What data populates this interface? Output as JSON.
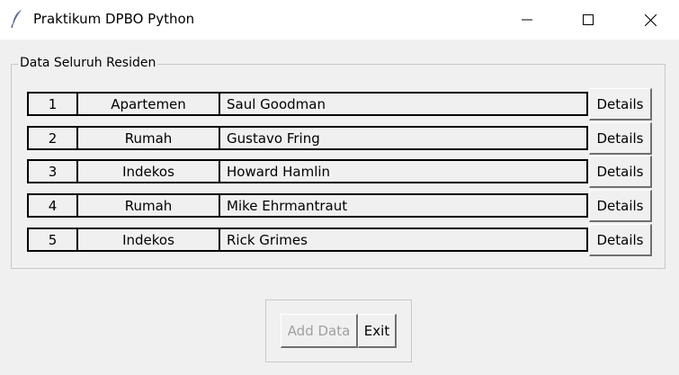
{
  "window": {
    "title": "Praktikum DPBO Python",
    "icon": "feather-icon",
    "controls": [
      "minimize-icon",
      "maximize-icon",
      "close-icon"
    ]
  },
  "frame": {
    "label": "Data Seluruh Residen"
  },
  "residents": [
    {
      "no": "1",
      "type": "Apartemen",
      "name": "Saul Goodman",
      "action": "Details"
    },
    {
      "no": "2",
      "type": "Rumah",
      "name": "Gustavo Fring",
      "action": "Details"
    },
    {
      "no": "3",
      "type": "Indekos",
      "name": "Howard Hamlin",
      "action": "Details"
    },
    {
      "no": "4",
      "type": "Rumah",
      "name": "Mike Ehrmantraut",
      "action": "Details"
    },
    {
      "no": "5",
      "type": "Indekos",
      "name": "Rick Grimes",
      "action": "Details"
    }
  ],
  "buttons": {
    "add_data": "Add Data",
    "exit": "Exit"
  },
  "colors": {
    "background": "#f0f0f0",
    "titlebar": "#ffffff",
    "disabled_text": "#a0a0a0"
  }
}
